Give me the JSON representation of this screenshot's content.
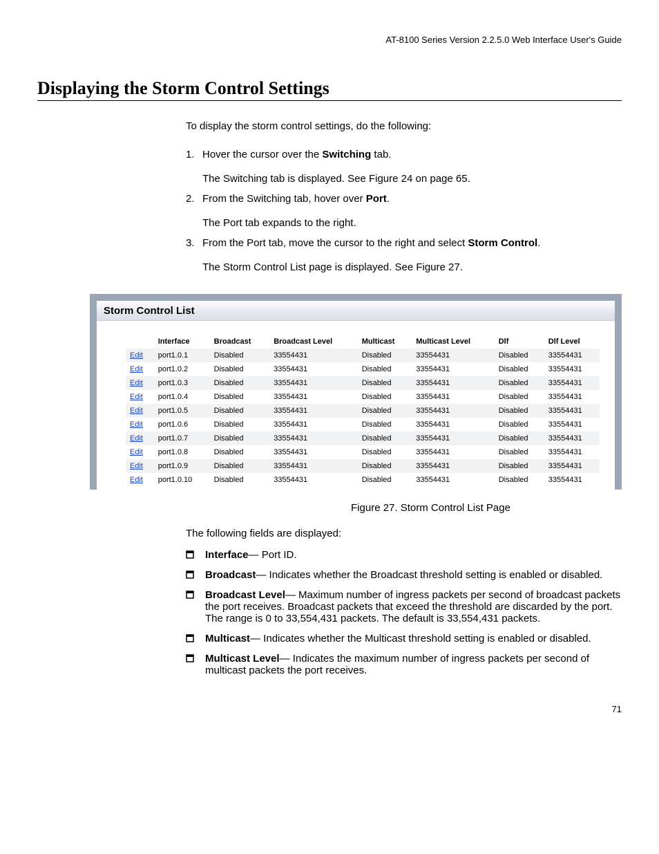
{
  "header": "AT-8100 Series Version 2.2.5.0 Web Interface User's Guide",
  "h1": "Displaying the Storm Control Settings",
  "intro": "To display the storm control settings, do the following:",
  "steps": [
    {
      "num": "1.",
      "lines": [
        [
          "Hover the cursor over the ",
          "Switching",
          " tab."
        ],
        [
          "The Switching tab is displayed. See Figure 24 on page 65."
        ]
      ]
    },
    {
      "num": "2.",
      "lines": [
        [
          "From the Switching tab, hover over ",
          "Port",
          "."
        ],
        [
          "The Port tab expands to the right."
        ]
      ]
    },
    {
      "num": "3.",
      "lines": [
        [
          "From the Port tab, move the cursor to the right and select ",
          "Storm Control",
          "."
        ],
        [
          "The Storm Control List page is displayed. See Figure 27."
        ]
      ]
    }
  ],
  "panel": {
    "title": "Storm Control List",
    "columns": [
      "",
      "Interface",
      "Broadcast",
      "Broadcast Level",
      "Multicast",
      "Multicast Level",
      "Dlf",
      "Dlf Level"
    ],
    "edit_label": "Edit",
    "rows": [
      [
        "port1.0.1",
        "Disabled",
        "33554431",
        "Disabled",
        "33554431",
        "Disabled",
        "33554431"
      ],
      [
        "port1.0.2",
        "Disabled",
        "33554431",
        "Disabled",
        "33554431",
        "Disabled",
        "33554431"
      ],
      [
        "port1.0.3",
        "Disabled",
        "33554431",
        "Disabled",
        "33554431",
        "Disabled",
        "33554431"
      ],
      [
        "port1.0.4",
        "Disabled",
        "33554431",
        "Disabled",
        "33554431",
        "Disabled",
        "33554431"
      ],
      [
        "port1.0.5",
        "Disabled",
        "33554431",
        "Disabled",
        "33554431",
        "Disabled",
        "33554431"
      ],
      [
        "port1.0.6",
        "Disabled",
        "33554431",
        "Disabled",
        "33554431",
        "Disabled",
        "33554431"
      ],
      [
        "port1.0.7",
        "Disabled",
        "33554431",
        "Disabled",
        "33554431",
        "Disabled",
        "33554431"
      ],
      [
        "port1.0.8",
        "Disabled",
        "33554431",
        "Disabled",
        "33554431",
        "Disabled",
        "33554431"
      ],
      [
        "port1.0.9",
        "Disabled",
        "33554431",
        "Disabled",
        "33554431",
        "Disabled",
        "33554431"
      ],
      [
        "port1.0.10",
        "Disabled",
        "33554431",
        "Disabled",
        "33554431",
        "Disabled",
        "33554431"
      ]
    ]
  },
  "caption": "Figure 27. Storm Control List Page",
  "followup": "The following fields are displayed:",
  "defs": [
    {
      "term": "Interface",
      "text": "— Port ID."
    },
    {
      "term": "Broadcast",
      "text": "— Indicates whether the Broadcast threshold setting is enabled or disabled."
    },
    {
      "term": "Broadcast Level",
      "text": "— Maximum number of ingress packets per second of broadcast packets the port receives. Broadcast packets that exceed the threshold are discarded by the port. The range is 0 to 33,554,431 packets. The default is 33,554,431 packets."
    },
    {
      "term": "Multicast",
      "text": "— Indicates whether the Multicast threshold setting is enabled or disabled."
    },
    {
      "term": "Multicast Level",
      "text": "— Indicates the maximum number of ingress packets per second of multicast packets the port receives."
    }
  ],
  "pagenum": "71"
}
